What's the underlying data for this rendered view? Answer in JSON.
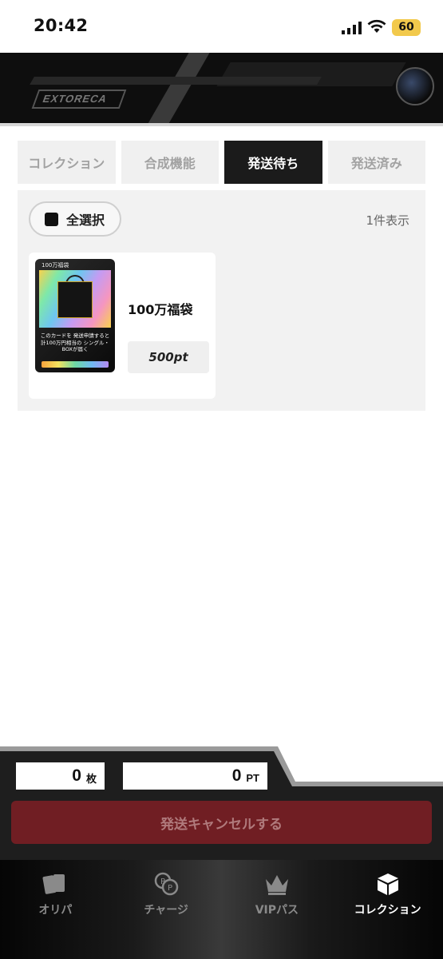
{
  "status_bar": {
    "time": "20:42",
    "battery": "60",
    "icons": [
      "cellular-signal-icon",
      "wifi-icon",
      "battery-icon"
    ]
  },
  "header": {
    "logo_text": "EXTORECA"
  },
  "tabs": [
    {
      "label": "コレクション",
      "active": false
    },
    {
      "label": "合成機能",
      "active": false
    },
    {
      "label": "発送待ち",
      "active": true
    },
    {
      "label": "発送済み",
      "active": false
    }
  ],
  "list": {
    "select_all_label": "全選択",
    "count_label": "1件表示",
    "items": [
      {
        "name": "100万福袋",
        "price": "500pt",
        "card_title": "100万福袋",
        "card_text": "このカードを 発送申請すると 計100万円相当の シングル・BOXが届く"
      }
    ]
  },
  "summary": {
    "sheets_value": "0",
    "sheets_unit": "枚",
    "points_value": "0",
    "points_unit": "PT",
    "cancel_button_label": "発送キャンセルする"
  },
  "bottom_nav": [
    {
      "label": "オリパ",
      "icon": "cards-icon",
      "active": false
    },
    {
      "label": "チャージ",
      "icon": "coins-icon",
      "active": false
    },
    {
      "label": "VIPパス",
      "icon": "crown-icon",
      "active": false
    },
    {
      "label": "コレクション",
      "icon": "box-icon",
      "active": true
    }
  ],
  "colors": {
    "accent_dark": "#1b1b1b",
    "cancel_button": "#701e23",
    "battery": "#f2c94c"
  }
}
